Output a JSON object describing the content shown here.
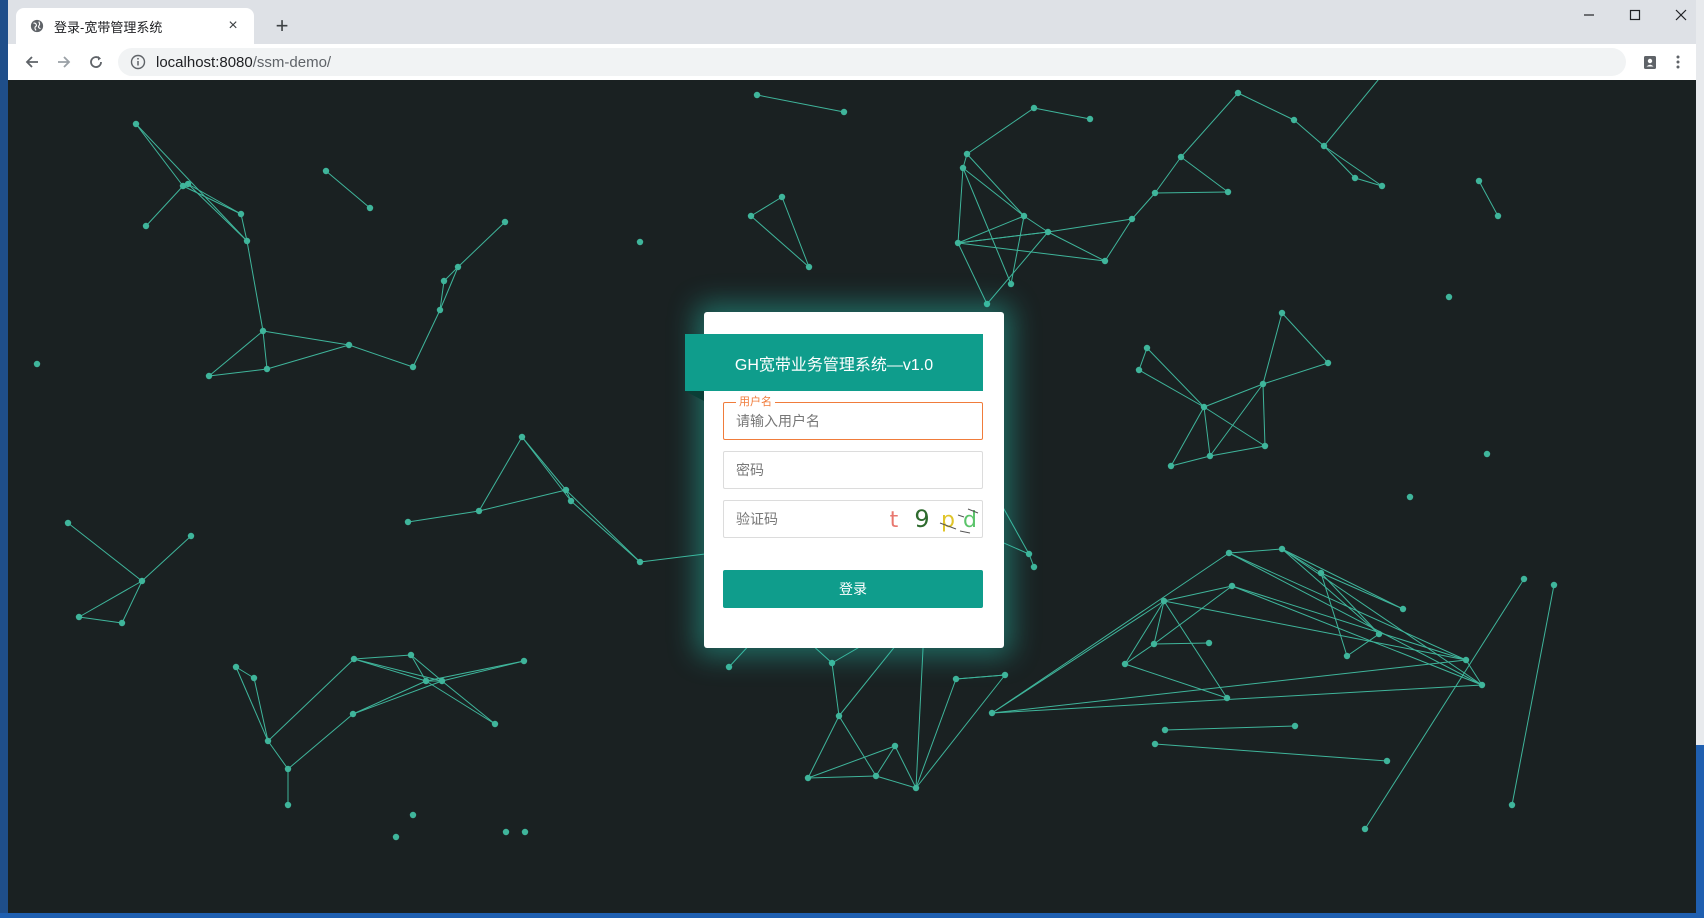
{
  "browser": {
    "tab_title": "登录-宽带管理系统",
    "tab_close": "×",
    "new_tab": "+",
    "url_host": "localhost:8080",
    "url_path": "/ssm-demo/"
  },
  "login": {
    "system_title": "GH宽带业务管理系统—v1.0",
    "username_legend": "用户名",
    "username_placeholder": "请输入用户名",
    "password_placeholder": "密码",
    "captcha_placeholder": "验证码",
    "captcha_chars": [
      "t",
      "9",
      "p",
      "d"
    ],
    "captcha_colors": [
      "#e8776f",
      "#2e6b2e",
      "#e0c52a",
      "#5bc46a"
    ],
    "login_button": "登录"
  },
  "colors": {
    "accent": "#0f9d8c",
    "background": "#1a2122",
    "network_line": "#3fb59b",
    "focus_border": "#f07c3b"
  }
}
